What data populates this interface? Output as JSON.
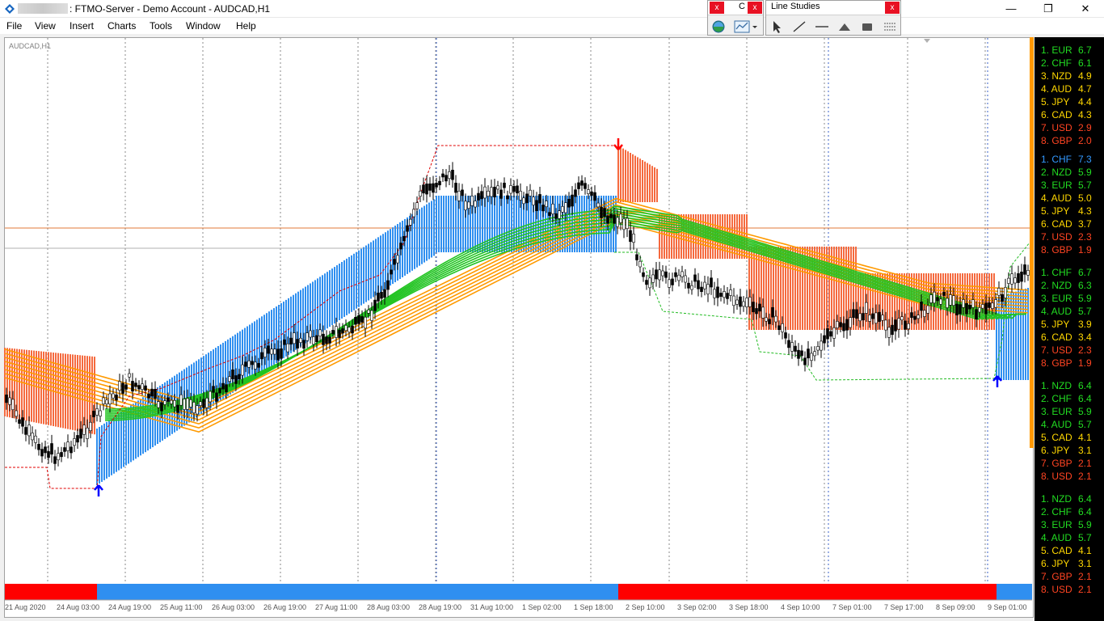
{
  "window": {
    "title": ": FTMO-Server - Demo Account - AUDCAD,H1",
    "minimize": "—",
    "maximize": "❐",
    "close": "✕"
  },
  "menu": [
    "File",
    "View",
    "Insert",
    "Charts",
    "Tools",
    "Window",
    "Help"
  ],
  "toolbar_c": {
    "title": "C",
    "close": "x"
  },
  "toolbar_line_studies": {
    "title": "Line Studies",
    "close": "x"
  },
  "chart": {
    "symbol_label": "AUDCAD,H1",
    "colors": {
      "up_band": "#2f8ff0",
      "down_band": "#f56a3f",
      "ribbon_orange": "#ff9a00",
      "ribbon_green": "#22c422",
      "trend_red": "#ff0000",
      "trend_blue": "#2f8ff0",
      "arrow_up": "#0000ff",
      "arrow_down": "#ff0000"
    },
    "time_axis": [
      "21 Aug 2020",
      "24 Aug 03:00",
      "24 Aug 19:00",
      "25 Aug 11:00",
      "26 Aug 03:00",
      "26 Aug 19:00",
      "27 Aug 11:00",
      "28 Aug 03:00",
      "28 Aug 19:00",
      "31 Aug 10:00",
      "1 Sep 02:00",
      "1 Sep 18:00",
      "2 Sep 10:00",
      "3 Sep 02:00",
      "3 Sep 18:00",
      "4 Sep 10:00",
      "7 Sep 01:00",
      "7 Sep 17:00",
      "8 Sep 09:00",
      "9 Sep 01:00"
    ]
  },
  "strength": [
    [
      {
        "rank": "1.",
        "cur": "EUR",
        "val": "6.7",
        "color": "#22dd22"
      },
      {
        "rank": "2.",
        "cur": "CHF",
        "val": "6.1",
        "color": "#22dd22"
      },
      {
        "rank": "3.",
        "cur": "NZD",
        "val": "4.9",
        "color": "#ffd700"
      },
      {
        "rank": "4.",
        "cur": "AUD",
        "val": "4.7",
        "color": "#ffd700"
      },
      {
        "rank": "5.",
        "cur": "JPY",
        "val": "4.4",
        "color": "#ffd700"
      },
      {
        "rank": "6.",
        "cur": "CAD",
        "val": "4.3",
        "color": "#ffd700"
      },
      {
        "rank": "7.",
        "cur": "USD",
        "val": "2.9",
        "color": "#ff4422"
      },
      {
        "rank": "8.",
        "cur": "GBP",
        "val": "2.0",
        "color": "#ff4422"
      }
    ],
    [
      {
        "rank": "1.",
        "cur": "CHF",
        "val": "7.3",
        "color": "#3399ff"
      },
      {
        "rank": "2.",
        "cur": "NZD",
        "val": "5.9",
        "color": "#22dd22"
      },
      {
        "rank": "3.",
        "cur": "EUR",
        "val": "5.7",
        "color": "#22dd22"
      },
      {
        "rank": "4.",
        "cur": "AUD",
        "val": "5.0",
        "color": "#ffd700"
      },
      {
        "rank": "5.",
        "cur": "JPY",
        "val": "4.3",
        "color": "#ffd700"
      },
      {
        "rank": "6.",
        "cur": "CAD",
        "val": "3.7",
        "color": "#ffd700"
      },
      {
        "rank": "7.",
        "cur": "USD",
        "val": "2.3",
        "color": "#ff4422"
      },
      {
        "rank": "8.",
        "cur": "GBP",
        "val": "1.9",
        "color": "#ff4422"
      }
    ],
    [
      {
        "rank": "1.",
        "cur": "CHF",
        "val": "6.7",
        "color": "#22dd22"
      },
      {
        "rank": "2.",
        "cur": "NZD",
        "val": "6.3",
        "color": "#22dd22"
      },
      {
        "rank": "3.",
        "cur": "EUR",
        "val": "5.9",
        "color": "#22dd22"
      },
      {
        "rank": "4.",
        "cur": "AUD",
        "val": "5.7",
        "color": "#22dd22"
      },
      {
        "rank": "5.",
        "cur": "JPY",
        "val": "3.9",
        "color": "#ffd700"
      },
      {
        "rank": "6.",
        "cur": "CAD",
        "val": "3.4",
        "color": "#ffd700"
      },
      {
        "rank": "7.",
        "cur": "USD",
        "val": "2.3",
        "color": "#ff4422"
      },
      {
        "rank": "8.",
        "cur": "GBP",
        "val": "1.9",
        "color": "#ff4422"
      }
    ],
    [
      {
        "rank": "1.",
        "cur": "NZD",
        "val": "6.4",
        "color": "#22dd22"
      },
      {
        "rank": "2.",
        "cur": "CHF",
        "val": "6.4",
        "color": "#22dd22"
      },
      {
        "rank": "3.",
        "cur": "EUR",
        "val": "5.9",
        "color": "#22dd22"
      },
      {
        "rank": "4.",
        "cur": "AUD",
        "val": "5.7",
        "color": "#22dd22"
      },
      {
        "rank": "5.",
        "cur": "CAD",
        "val": "4.1",
        "color": "#ffd700"
      },
      {
        "rank": "6.",
        "cur": "JPY",
        "val": "3.1",
        "color": "#ffd700"
      },
      {
        "rank": "7.",
        "cur": "GBP",
        "val": "2.1",
        "color": "#ff4422"
      },
      {
        "rank": "8.",
        "cur": "USD",
        "val": "2.1",
        "color": "#ff4422"
      }
    ],
    [
      {
        "rank": "1.",
        "cur": "NZD",
        "val": "6.4",
        "color": "#22dd22"
      },
      {
        "rank": "2.",
        "cur": "CHF",
        "val": "6.4",
        "color": "#22dd22"
      },
      {
        "rank": "3.",
        "cur": "EUR",
        "val": "5.9",
        "color": "#22dd22"
      },
      {
        "rank": "4.",
        "cur": "AUD",
        "val": "5.7",
        "color": "#22dd22"
      },
      {
        "rank": "5.",
        "cur": "CAD",
        "val": "4.1",
        "color": "#ffd700"
      },
      {
        "rank": "6.",
        "cur": "JPY",
        "val": "3.1",
        "color": "#ffd700"
      },
      {
        "rank": "7.",
        "cur": "GBP",
        "val": "2.1",
        "color": "#ff4422"
      },
      {
        "rank": "8.",
        "cur": "USD",
        "val": "2.1",
        "color": "#ff4422"
      }
    ]
  ]
}
